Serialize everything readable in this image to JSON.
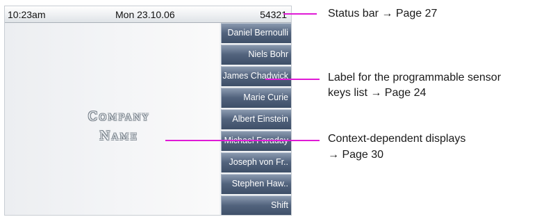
{
  "status_bar": {
    "time": "10:23am",
    "date": "Mon 23.10.06",
    "number": "54321"
  },
  "logo": {
    "line1": "Company",
    "line2": "Name"
  },
  "sensor_keys": [
    "Daniel Bernoulli",
    "Niels Bohr",
    "James Chadwick",
    "Marie Curie",
    "Albert Einstein",
    "Michael Faraday",
    "Joseph von Fr..",
    "Stephen Haw..",
    "Shift"
  ],
  "callouts": {
    "status_bar": "Status bar → Page 27",
    "sensor_keys_line1": "Label for the programmable sensor",
    "sensor_keys_line2": "keys list → Page 24",
    "context_line1": "Context-dependent displays",
    "context_line2": "→ Page 30"
  },
  "colors": {
    "callout_line": "#e01ad6",
    "key_bg": "#52637d"
  }
}
